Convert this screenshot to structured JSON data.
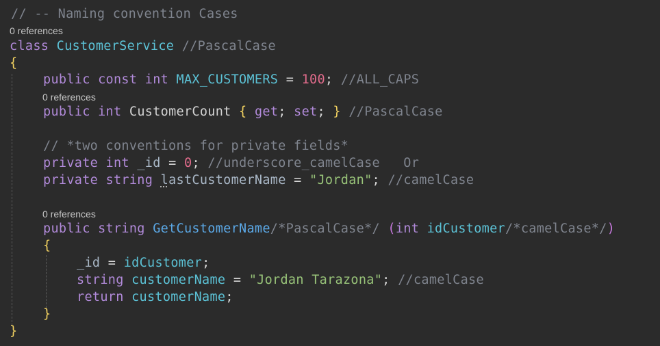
{
  "lens": {
    "class_refs": "0 references",
    "prop_refs": "0 references",
    "method_refs": "0 references"
  },
  "code": {
    "l1": {
      "comment": "// -- Naming convention Cases"
    },
    "l2": {
      "kw": "class",
      "name": "CustomerService",
      "comment": "//PascalCase"
    },
    "l3": {
      "brace": "{"
    },
    "l4": {
      "kw1": "public",
      "kw2": "const",
      "kw3": "int",
      "name": "MAX_CUSTOMERS",
      "eq": "=",
      "num": "100",
      "semi": ";",
      "comment": "//ALL_CAPS"
    },
    "l5": {
      "kw1": "public",
      "kw2": "int",
      "name": "CustomerCount",
      "open": "{",
      "get": "get",
      "s1": ";",
      "set": "set",
      "s2": ";",
      "close": "}",
      "comment": "//PascalCase"
    },
    "l6": {
      "comment": "// *two conventions for private fields*"
    },
    "l7": {
      "kw1": "private",
      "kw2": "int",
      "name": "_id",
      "eq": "=",
      "num": "0",
      "semi": ";",
      "comment": "//underscore_camelCase   Or"
    },
    "l8": {
      "kw1": "private",
      "kw2": "string",
      "name_a": "l",
      "name_b": "astCustomerName",
      "eq": "=",
      "str": "\"Jordan\"",
      "semi": ";",
      "comment": "//camelCase"
    },
    "l9": {
      "kw1": "public",
      "kw2": "string",
      "name": "GetCustomerName",
      "cmt1": "/*PascalCase*/",
      "p_open": "(",
      "kw3": "int",
      "param": "idCustomer",
      "cmt2": "/*camelCase*/",
      "p_close": ")"
    },
    "l10": {
      "brace": "{"
    },
    "l11": {
      "name": "_id",
      "eq": "=",
      "val": "idCustomer",
      "semi": ";"
    },
    "l12": {
      "kw": "string",
      "name": "customerName",
      "eq": "=",
      "str": "\"Jordan Tarazona\"",
      "semi": ";",
      "comment": "//camelCase"
    },
    "l13": {
      "kw": "return",
      "val": "customerName",
      "semi": ";"
    },
    "l14": {
      "brace": "}"
    },
    "l15": {
      "brace": "}"
    }
  }
}
